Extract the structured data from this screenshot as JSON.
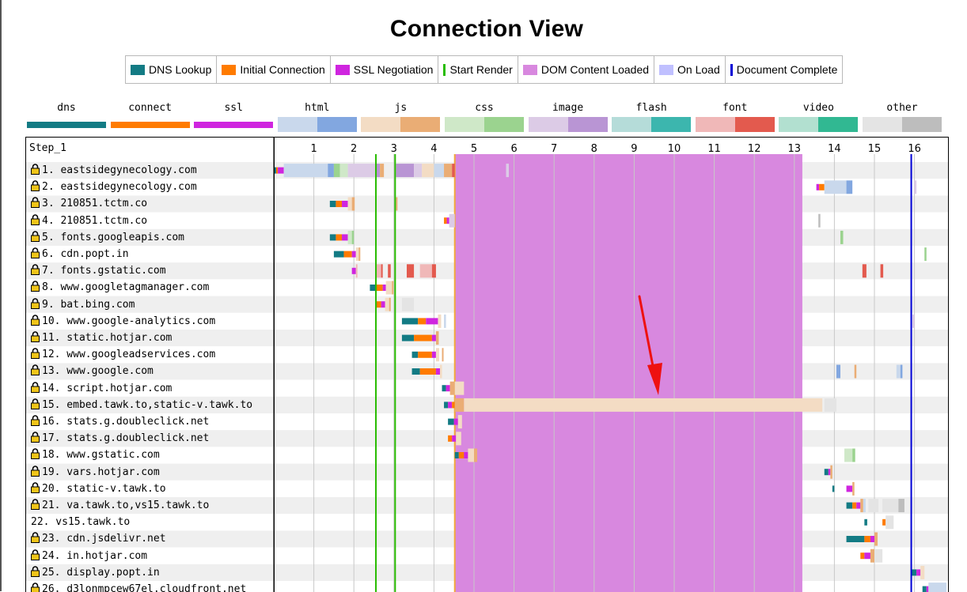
{
  "title": "Connection View",
  "legend": [
    {
      "label": "DNS Lookup",
      "color": "#137b84",
      "style": "box"
    },
    {
      "label": "Initial Connection",
      "color": "#ff7b00",
      "style": "box"
    },
    {
      "label": "SSL Negotiation",
      "color": "#cf25df",
      "style": "box"
    },
    {
      "label": "Start Render",
      "color": "#28bc00",
      "style": "line"
    },
    {
      "label": "DOM Content Loaded",
      "color": "#d888df",
      "style": "box"
    },
    {
      "label": "On Load",
      "color": "#c0c0ff",
      "style": "box"
    },
    {
      "label": "Document Complete",
      "color": "#0000d6",
      "style": "line"
    }
  ],
  "request_types": [
    {
      "label": "dns",
      "light": "#137b84",
      "dark": "#137b84",
      "kind": "thin"
    },
    {
      "label": "connect",
      "light": "#ff7b00",
      "dark": "#ff7b00",
      "kind": "thin"
    },
    {
      "label": "ssl",
      "light": "#cf25df",
      "dark": "#cf25df",
      "kind": "thin"
    },
    {
      "label": "html",
      "light": "#c9d8ec",
      "dark": "#82a7e0",
      "kind": "split"
    },
    {
      "label": "js",
      "light": "#f3dcc4",
      "dark": "#eaad75",
      "kind": "split"
    },
    {
      "label": "css",
      "light": "#cfe8c8",
      "dark": "#9bd38f",
      "kind": "split"
    },
    {
      "label": "image",
      "light": "#dccbe6",
      "dark": "#b995d4",
      "kind": "split"
    },
    {
      "label": "flash",
      "light": "#b5dcd9",
      "dark": "#3cb6ae",
      "kind": "split"
    },
    {
      "label": "font",
      "light": "#f0b8b8",
      "dark": "#e35a4e",
      "kind": "split"
    },
    {
      "label": "video",
      "light": "#b2e0d0",
      "dark": "#31b892",
      "kind": "split"
    },
    {
      "label": "other",
      "light": "#e4e4e4",
      "dark": "#bdbdbd",
      "kind": "split"
    }
  ],
  "chart_data": {
    "type": "waterfall",
    "title": "Connection View",
    "step_label": "Step_1",
    "x_axis": {
      "min": 0,
      "max": 16.8,
      "ticks": [
        1,
        2,
        3,
        4,
        5,
        6,
        7,
        8,
        9,
        10,
        11,
        12,
        13,
        14,
        15,
        16
      ]
    },
    "markers": {
      "start_render": [
        2.55,
        3.03
      ],
      "dom_content_loaded": {
        "start": 4.52,
        "end": 13.2
      },
      "document_complete": 15.92
    },
    "rows": [
      {
        "label": "1. eastsidegynecology.com",
        "secure": true,
        "bars": [
          {
            "s": 0.02,
            "e": 0.06,
            "c": "#137b84"
          },
          {
            "s": 0.06,
            "e": 0.1,
            "c": "#ff7b00"
          },
          {
            "s": 0.1,
            "e": 0.25,
            "c": "#cf25df"
          },
          {
            "s": 0.25,
            "e": 1.35,
            "c": "#c9d8ec"
          },
          {
            "s": 1.35,
            "e": 1.5,
            "c": "#82a7e0"
          },
          {
            "s": 1.5,
            "e": 1.65,
            "c": "#9bd38f"
          },
          {
            "s": 1.65,
            "e": 1.85,
            "c": "#cfe8c8"
          },
          {
            "s": 1.85,
            "e": 2.55,
            "c": "#dccbe6"
          },
          {
            "s": 2.55,
            "e": 2.65,
            "c": "#b995d4"
          },
          {
            "s": 2.65,
            "e": 2.75,
            "c": "#eaad75"
          },
          {
            "s": 3.05,
            "e": 3.5,
            "c": "#b995d4"
          },
          {
            "s": 3.5,
            "e": 3.7,
            "c": "#dccbe6"
          },
          {
            "s": 3.7,
            "e": 4.0,
            "c": "#f3dcc4"
          },
          {
            "s": 4.0,
            "e": 4.25,
            "c": "#c9d8ec"
          },
          {
            "s": 4.25,
            "e": 4.45,
            "c": "#eaad75"
          },
          {
            "s": 4.45,
            "e": 4.52,
            "c": "#e35a4e"
          },
          {
            "s": 5.8,
            "e": 5.87,
            "c": "#dccbe6"
          }
        ]
      },
      {
        "label": "2. eastsidegynecology.com",
        "secure": true,
        "bars": [
          {
            "s": 13.55,
            "e": 13.62,
            "c": "#cf25df"
          },
          {
            "s": 13.62,
            "e": 13.75,
            "c": "#ff7b00"
          },
          {
            "s": 13.75,
            "e": 14.3,
            "c": "#c9d8ec"
          },
          {
            "s": 14.3,
            "e": 14.45,
            "c": "#82a7e0"
          },
          {
            "s": 16.0,
            "e": 16.05,
            "c": "#dccbe6"
          }
        ]
      },
      {
        "label": "3. 210851.tctm.co",
        "secure": true,
        "bars": [
          {
            "s": 1.4,
            "e": 1.55,
            "c": "#137b84"
          },
          {
            "s": 1.55,
            "e": 1.7,
            "c": "#ff7b00"
          },
          {
            "s": 1.7,
            "e": 1.85,
            "c": "#cf25df"
          },
          {
            "s": 1.85,
            "e": 1.95,
            "c": "#f3dcc4"
          },
          {
            "s": 1.95,
            "e": 2.02,
            "c": "#eaad75"
          },
          {
            "s": 3.05,
            "e": 3.08,
            "c": "#eaad75"
          }
        ]
      },
      {
        "label": "4. 210851.tctm.co",
        "secure": true,
        "bars": [
          {
            "s": 4.25,
            "e": 4.32,
            "c": "#ff7b00"
          },
          {
            "s": 4.32,
            "e": 4.38,
            "c": "#cf25df"
          },
          {
            "s": 4.38,
            "e": 4.52,
            "c": "#dccbe6"
          },
          {
            "s": 13.6,
            "e": 13.65,
            "c": "#bdbdbd"
          }
        ]
      },
      {
        "label": "5. fonts.googleapis.com",
        "secure": true,
        "bars": [
          {
            "s": 1.4,
            "e": 1.55,
            "c": "#137b84"
          },
          {
            "s": 1.55,
            "e": 1.7,
            "c": "#ff7b00"
          },
          {
            "s": 1.7,
            "e": 1.85,
            "c": "#cf25df"
          },
          {
            "s": 1.85,
            "e": 1.95,
            "c": "#cfe8c8"
          },
          {
            "s": 1.95,
            "e": 2.0,
            "c": "#9bd38f"
          },
          {
            "s": 14.15,
            "e": 14.22,
            "c": "#9bd38f"
          }
        ]
      },
      {
        "label": "6. cdn.popt.in",
        "secure": true,
        "bars": [
          {
            "s": 1.5,
            "e": 1.75,
            "c": "#137b84"
          },
          {
            "s": 1.75,
            "e": 1.95,
            "c": "#ff7b00"
          },
          {
            "s": 1.95,
            "e": 2.05,
            "c": "#cf25df"
          },
          {
            "s": 2.05,
            "e": 2.12,
            "c": "#f3dcc4"
          },
          {
            "s": 2.12,
            "e": 2.16,
            "c": "#eaad75"
          },
          {
            "s": 16.25,
            "e": 16.3,
            "c": "#9bd38f"
          }
        ]
      },
      {
        "label": "7. fonts.gstatic.com",
        "secure": true,
        "bars": [
          {
            "s": 1.95,
            "e": 2.05,
            "c": "#cf25df"
          },
          {
            "s": 2.05,
            "e": 2.08,
            "c": "#f0b8b8"
          },
          {
            "s": 2.55,
            "e": 2.68,
            "c": "#f0b8b8"
          },
          {
            "s": 2.68,
            "e": 2.72,
            "c": "#e35a4e"
          },
          {
            "s": 2.85,
            "e": 2.92,
            "c": "#e35a4e"
          },
          {
            "s": 3.32,
            "e": 3.5,
            "c": "#e35a4e"
          },
          {
            "s": 3.65,
            "e": 3.95,
            "c": "#f0b8b8"
          },
          {
            "s": 3.95,
            "e": 4.05,
            "c": "#e35a4e"
          },
          {
            "s": 14.7,
            "e": 14.8,
            "c": "#e35a4e"
          },
          {
            "s": 15.15,
            "e": 15.22,
            "c": "#e35a4e"
          }
        ]
      },
      {
        "label": "8. www.googletagmanager.com",
        "secure": true,
        "bars": [
          {
            "s": 2.4,
            "e": 2.55,
            "c": "#137b84"
          },
          {
            "s": 2.55,
            "e": 2.72,
            "c": "#ff7b00"
          },
          {
            "s": 2.72,
            "e": 2.8,
            "c": "#cf25df"
          },
          {
            "s": 2.8,
            "e": 2.95,
            "c": "#f3dcc4"
          },
          {
            "s": 2.95,
            "e": 2.98,
            "c": "#eaad75"
          }
        ]
      },
      {
        "label": "9. bat.bing.com",
        "secure": true,
        "bars": [
          {
            "s": 2.55,
            "e": 2.68,
            "c": "#ff7b00"
          },
          {
            "s": 2.68,
            "e": 2.78,
            "c": "#cf25df"
          },
          {
            "s": 2.78,
            "e": 2.88,
            "c": "#f3dcc4"
          },
          {
            "s": 2.88,
            "e": 2.92,
            "c": "#eaad75"
          },
          {
            "s": 3.2,
            "e": 3.5,
            "c": "#e4e4e4"
          }
        ]
      },
      {
        "label": "10. www.google-analytics.com",
        "secure": true,
        "bars": [
          {
            "s": 3.2,
            "e": 3.6,
            "c": "#137b84"
          },
          {
            "s": 3.6,
            "e": 3.8,
            "c": "#ff7b00"
          },
          {
            "s": 3.8,
            "e": 4.1,
            "c": "#cf25df"
          },
          {
            "s": 4.1,
            "e": 4.18,
            "c": "#f3dcc4"
          },
          {
            "s": 4.25,
            "e": 4.3,
            "c": "#c9d8ec"
          },
          {
            "s": 15.95,
            "e": 16.0,
            "c": "#dccbe6"
          }
        ]
      },
      {
        "label": "11. static.hotjar.com",
        "secure": true,
        "bars": [
          {
            "s": 3.2,
            "e": 3.5,
            "c": "#137b84"
          },
          {
            "s": 3.5,
            "e": 3.95,
            "c": "#ff7b00"
          },
          {
            "s": 3.95,
            "e": 4.05,
            "c": "#cf25df"
          },
          {
            "s": 4.05,
            "e": 4.12,
            "c": "#eaad75"
          }
        ]
      },
      {
        "label": "12. www.googleadservices.com",
        "secure": true,
        "bars": [
          {
            "s": 3.45,
            "e": 3.6,
            "c": "#137b84"
          },
          {
            "s": 3.6,
            "e": 3.95,
            "c": "#ff7b00"
          },
          {
            "s": 3.95,
            "e": 4.05,
            "c": "#cf25df"
          },
          {
            "s": 4.05,
            "e": 4.13,
            "c": "#f3dcc4"
          },
          {
            "s": 4.2,
            "e": 4.23,
            "c": "#eaad75"
          }
        ]
      },
      {
        "label": "13. www.google.com",
        "secure": true,
        "bars": [
          {
            "s": 3.45,
            "e": 3.65,
            "c": "#137b84"
          },
          {
            "s": 3.65,
            "e": 4.05,
            "c": "#ff7b00"
          },
          {
            "s": 4.05,
            "e": 4.15,
            "c": "#cf25df"
          },
          {
            "s": 4.15,
            "e": 4.2,
            "c": "#f3dcc4"
          },
          {
            "s": 14.05,
            "e": 14.15,
            "c": "#82a7e0"
          },
          {
            "s": 14.5,
            "e": 14.55,
            "c": "#eaad75"
          },
          {
            "s": 15.55,
            "e": 15.65,
            "c": "#c9d8ec"
          },
          {
            "s": 15.65,
            "e": 15.7,
            "c": "#82a7e0"
          }
        ]
      },
      {
        "label": "14. script.hotjar.com",
        "secure": true,
        "bars": [
          {
            "s": 4.2,
            "e": 4.3,
            "c": "#137b84"
          },
          {
            "s": 4.3,
            "e": 4.4,
            "c": "#cf25df"
          },
          {
            "s": 4.4,
            "e": 4.52,
            "c": "#eaad75"
          },
          {
            "s": 4.52,
            "e": 4.75,
            "c": "#f3dcc4"
          }
        ]
      },
      {
        "label": "15. embed.tawk.to,static-v.tawk.to",
        "secure": true,
        "bars": [
          {
            "s": 4.25,
            "e": 4.35,
            "c": "#137b84"
          },
          {
            "s": 4.35,
            "e": 4.45,
            "c": "#cf25df"
          },
          {
            "s": 4.45,
            "e": 4.52,
            "c": "#ff7b00"
          },
          {
            "s": 4.52,
            "e": 4.75,
            "c": "#eaad75"
          },
          {
            "s": 4.75,
            "e": 13.7,
            "c": "#f3dcc4"
          },
          {
            "s": 13.75,
            "e": 14.05,
            "c": "#e4e4e4"
          }
        ]
      },
      {
        "label": "16. stats.g.doubleclick.net",
        "secure": true,
        "bars": [
          {
            "s": 4.35,
            "e": 4.5,
            "c": "#137b84"
          },
          {
            "s": 4.5,
            "e": 4.6,
            "c": "#cf25df"
          },
          {
            "s": 4.6,
            "e": 4.7,
            "c": "#f3dcc4"
          }
        ]
      },
      {
        "label": "17. stats.g.doubleclick.net",
        "secure": true,
        "bars": [
          {
            "s": 4.35,
            "e": 4.45,
            "c": "#ff7b00"
          },
          {
            "s": 4.45,
            "e": 4.55,
            "c": "#cf25df"
          },
          {
            "s": 4.55,
            "e": 4.68,
            "c": "#f3dcc4"
          }
        ]
      },
      {
        "label": "18. www.gstatic.com",
        "secure": true,
        "bars": [
          {
            "s": 4.52,
            "e": 4.62,
            "c": "#137b84"
          },
          {
            "s": 4.62,
            "e": 4.75,
            "c": "#ff7b00"
          },
          {
            "s": 4.75,
            "e": 4.85,
            "c": "#cf25df"
          },
          {
            "s": 4.85,
            "e": 5.0,
            "c": "#f3dcc4"
          },
          {
            "s": 5.0,
            "e": 5.08,
            "c": "#eaad75"
          },
          {
            "s": 14.25,
            "e": 14.45,
            "c": "#cfe8c8"
          },
          {
            "s": 14.45,
            "e": 14.52,
            "c": "#9bd38f"
          }
        ]
      },
      {
        "label": "19. vars.hotjar.com",
        "secure": true,
        "bars": [
          {
            "s": 13.75,
            "e": 13.85,
            "c": "#137b84"
          },
          {
            "s": 13.85,
            "e": 13.9,
            "c": "#cf25df"
          },
          {
            "s": 13.9,
            "e": 13.95,
            "c": "#eaad75"
          }
        ]
      },
      {
        "label": "20. static-v.tawk.to",
        "secure": true,
        "bars": [
          {
            "s": 13.95,
            "e": 14.0,
            "c": "#137b84"
          },
          {
            "s": 14.3,
            "e": 14.45,
            "c": "#cf25df"
          },
          {
            "s": 14.45,
            "e": 14.5,
            "c": "#eaad75"
          }
        ]
      },
      {
        "label": "21. va.tawk.to,vs15.tawk.to",
        "secure": true,
        "bars": [
          {
            "s": 14.3,
            "e": 14.45,
            "c": "#137b84"
          },
          {
            "s": 14.45,
            "e": 14.55,
            "c": "#ff7b00"
          },
          {
            "s": 14.55,
            "e": 14.65,
            "c": "#cf25df"
          },
          {
            "s": 14.65,
            "e": 14.72,
            "c": "#eaad75"
          },
          {
            "s": 14.72,
            "e": 14.78,
            "c": "#c9d8ec"
          },
          {
            "s": 14.85,
            "e": 15.1,
            "c": "#e4e4e4"
          },
          {
            "s": 15.2,
            "e": 15.6,
            "c": "#e4e4e4"
          },
          {
            "s": 15.6,
            "e": 15.75,
            "c": "#bdbdbd"
          }
        ]
      },
      {
        "label": "22. vs15.tawk.to",
        "secure": false,
        "bars": [
          {
            "s": 14.75,
            "e": 14.82,
            "c": "#137b84"
          },
          {
            "s": 15.2,
            "e": 15.28,
            "c": "#ff7b00"
          },
          {
            "s": 15.28,
            "e": 15.48,
            "c": "#e4e4e4"
          }
        ]
      },
      {
        "label": "23. cdn.jsdelivr.net",
        "secure": true,
        "bars": [
          {
            "s": 14.3,
            "e": 14.75,
            "c": "#137b84"
          },
          {
            "s": 14.75,
            "e": 14.9,
            "c": "#ff7b00"
          },
          {
            "s": 14.9,
            "e": 15.0,
            "c": "#cf25df"
          },
          {
            "s": 15.0,
            "e": 15.08,
            "c": "#eaad75"
          }
        ]
      },
      {
        "label": "24. in.hotjar.com",
        "secure": true,
        "bars": [
          {
            "s": 14.65,
            "e": 14.75,
            "c": "#ff7b00"
          },
          {
            "s": 14.75,
            "e": 14.9,
            "c": "#cf25df"
          },
          {
            "s": 14.9,
            "e": 15.0,
            "c": "#eaad75"
          },
          {
            "s": 15.0,
            "e": 15.2,
            "c": "#e4e4e4"
          }
        ]
      },
      {
        "label": "25. display.popt.in",
        "secure": true,
        "bars": [
          {
            "s": 15.92,
            "e": 16.05,
            "c": "#137b84"
          },
          {
            "s": 16.05,
            "e": 16.15,
            "c": "#cf25df"
          },
          {
            "s": 16.15,
            "e": 16.25,
            "c": "#f3dcc4"
          }
        ]
      },
      {
        "label": "26. d3lonmpcew67el.cloudfront.net",
        "secure": true,
        "bars": [
          {
            "s": 16.2,
            "e": 16.3,
            "c": "#137b84"
          },
          {
            "s": 16.3,
            "e": 16.35,
            "c": "#cf25df"
          },
          {
            "s": 16.35,
            "e": 16.8,
            "c": "#c9d8ec"
          }
        ]
      }
    ]
  },
  "annotation": {
    "color": "#ee1111"
  }
}
